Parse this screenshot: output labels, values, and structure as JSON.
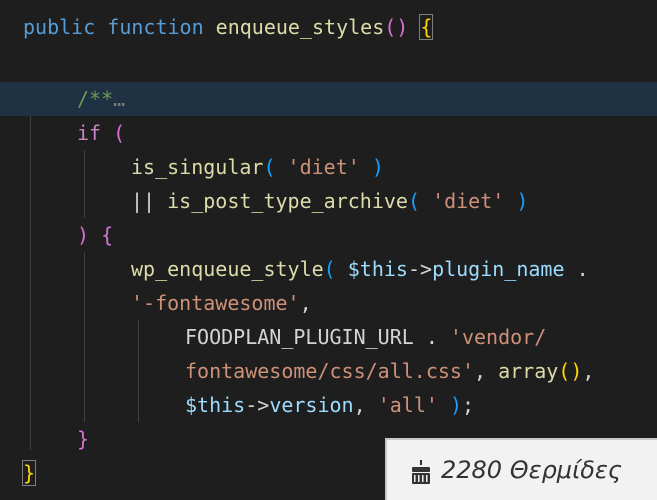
{
  "editor": {
    "line1": {
      "kw_public": "public",
      "kw_function": "function",
      "fn_name": "enqueue_styles",
      "paren_open": "(",
      "paren_close": ")",
      "brace_open": "{"
    },
    "line3": {
      "comment": "/**",
      "ellipsis": "…"
    },
    "line4": {
      "kw_if": "if",
      "paren_open": "("
    },
    "line5": {
      "fn": "is_singular",
      "paren_open": "(",
      "str": "'diet'",
      "paren_close": ")"
    },
    "line6": {
      "op": "||",
      "fn": "is_post_type_archive",
      "paren_open": "(",
      "str": "'diet'",
      "paren_close": ")"
    },
    "line7": {
      "paren_close": ")",
      "brace_open": "{"
    },
    "line8": {
      "fn": "wp_enqueue_style",
      "paren_open": "(",
      "var_this": "$this",
      "arrow": "->",
      "prop": "plugin_name",
      "concat": "."
    },
    "line9": {
      "str": "'-fontawesome'",
      "comma": ","
    },
    "line10": {
      "const": "FOODPLAN_PLUGIN_URL",
      "concat": ".",
      "str": "'vendor/"
    },
    "line11": {
      "str": "fontawesome/css/all.css'",
      "comma": ",",
      "fn": "array",
      "parens": "()",
      "comma2": ","
    },
    "line12": {
      "var_this": "$this",
      "arrow": "->",
      "prop": "version",
      "comma": ",",
      "str": "'all'",
      "paren_close": ")",
      "semicolon": ";"
    },
    "line13": {
      "brace_close": "}"
    },
    "line14": {
      "brace_close": "}"
    }
  },
  "badge": {
    "icon": "cake-icon",
    "text": "2280 Θερμίδες"
  },
  "colors": {
    "background": "#1e1e1e",
    "keyword": "#569cd6",
    "control": "#c586c0",
    "function": "#dcdcaa",
    "string": "#ce9178",
    "variable": "#9cdcfe",
    "comment": "#6a9955",
    "bracket_level1": "#ffd700",
    "bracket_level2": "#da70d6",
    "bracket_level3": "#179fff"
  }
}
